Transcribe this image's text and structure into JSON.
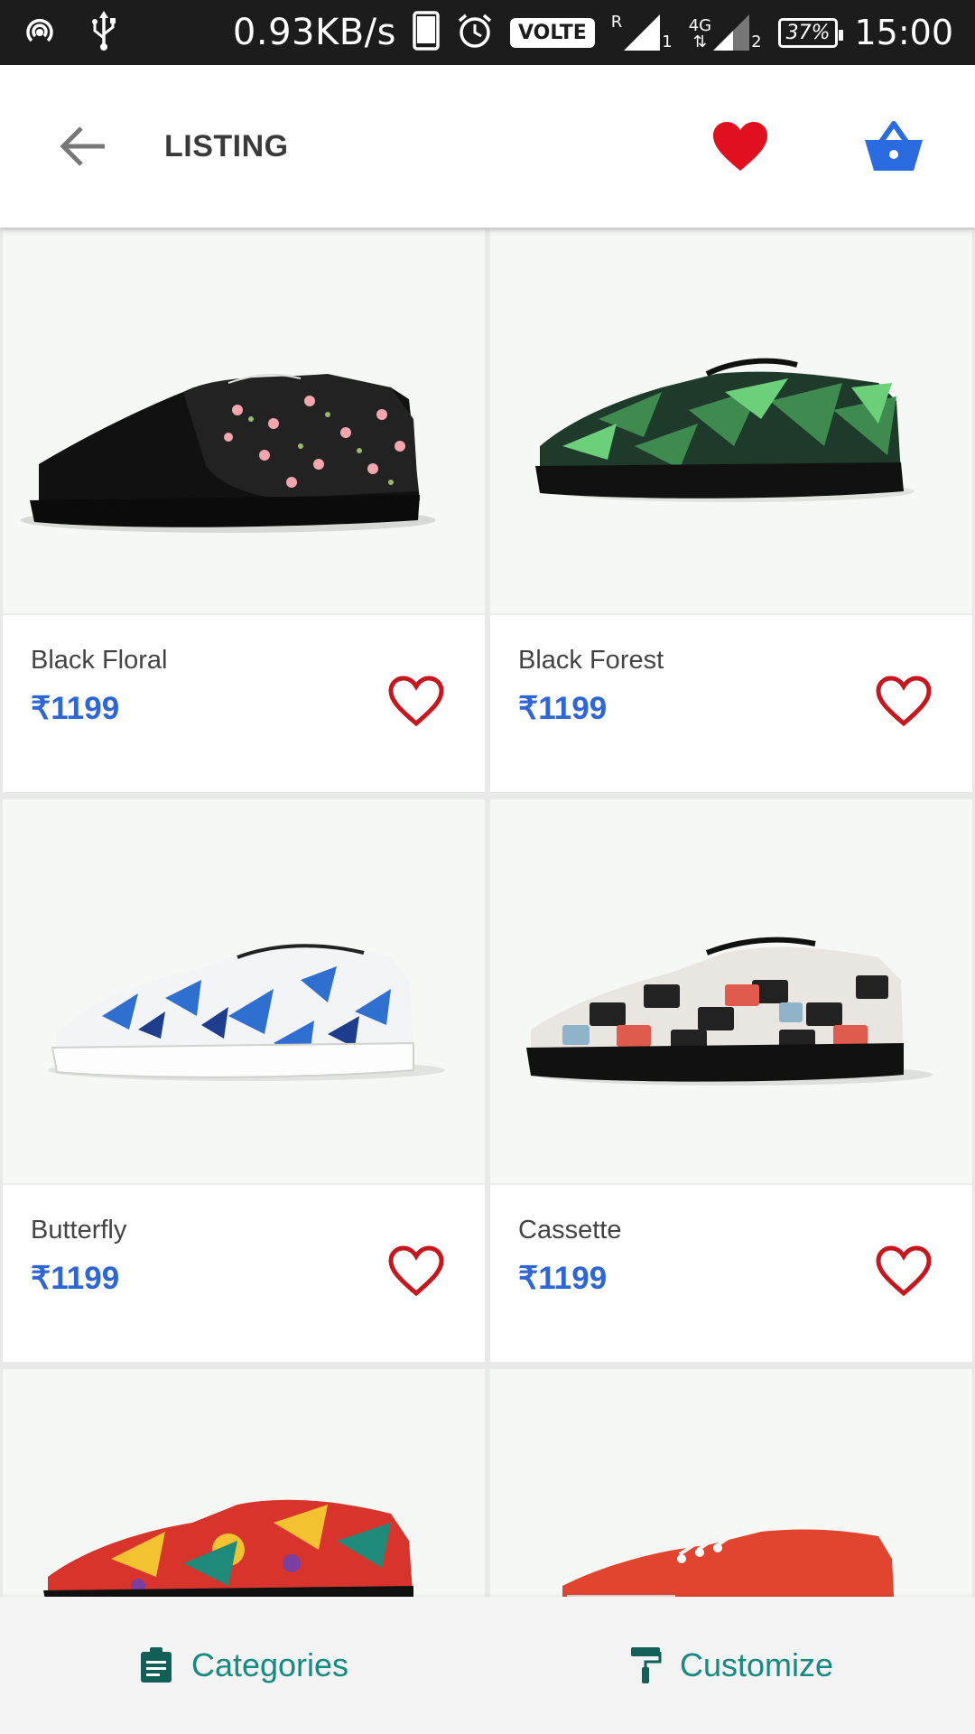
{
  "status_bar": {
    "net_speed": "0.93KB/s",
    "volte": "VOLTE",
    "roaming": "R",
    "network": "4G",
    "sim1": "1",
    "sim2": "2",
    "battery": "37%",
    "time": "15:00"
  },
  "app_bar": {
    "title": "LISTING",
    "back_icon": "arrow-left-icon",
    "wishlist_icon": "heart-filled-icon",
    "cart_icon": "basket-icon"
  },
  "products": [
    {
      "name": "Black Floral",
      "price": "₹1199"
    },
    {
      "name": "Black Forest",
      "price": "₹1199"
    },
    {
      "name": "Butterfly",
      "price": "₹1199"
    },
    {
      "name": "Cassette",
      "price": "₹1199"
    }
  ],
  "bottom_bar": {
    "categories": "Categories",
    "customize": "Customize"
  },
  "colors": {
    "price": "#2f66d6",
    "wishlist_heart": "#e01020",
    "fav_outline": "#c8161e",
    "cart": "#2b6be0",
    "bottom_accent": "#148a80"
  }
}
